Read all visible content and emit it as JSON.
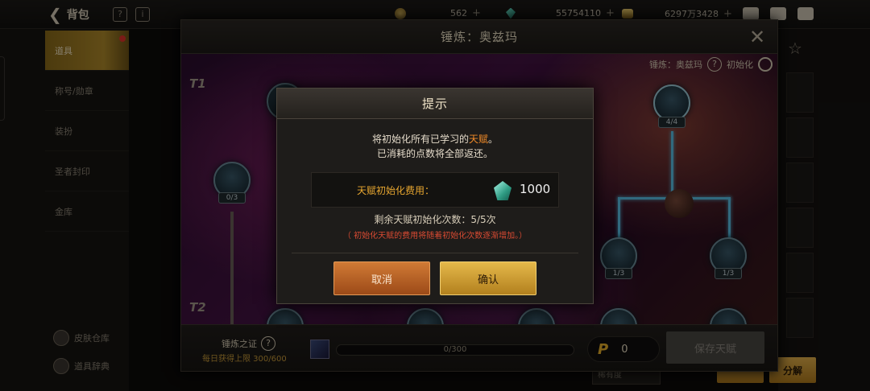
{
  "topbar": {
    "back_label": "背包",
    "currencies": [
      {
        "icon": "coin-icon",
        "value": "562"
      },
      {
        "icon": "gem-icon",
        "value": "55754110"
      },
      {
        "icon": "gold-icon",
        "value": "6297万3428"
      }
    ]
  },
  "sidebar": {
    "items": [
      {
        "label": "道具",
        "active": true,
        "badge": true
      },
      {
        "label": "称号/勋章"
      },
      {
        "label": "装扮"
      },
      {
        "label": "圣者封印"
      },
      {
        "label": "金库"
      }
    ],
    "bottom": [
      {
        "label": "皮肤仓库",
        "icon": "skin-storage-icon"
      },
      {
        "label": "道具辞典",
        "icon": "item-dictionary-icon"
      }
    ]
  },
  "right_panel": {
    "split_label": "分解",
    "bottom_select": "稀有度"
  },
  "forge": {
    "title": "锤炼：奥兹玛",
    "info_label": "锤炼：奥兹玛",
    "reset_label": "初始化",
    "tiers": [
      "T1",
      "T2"
    ],
    "nodes": [
      {
        "count": "0/3"
      },
      {
        "count": "4/4"
      },
      {
        "count": "1/3"
      },
      {
        "count": "1/3"
      }
    ],
    "footer": {
      "proof_title": "锤炼之证",
      "daily_limit": "每日获得上限 300/600",
      "progress": "0/300",
      "points": "0",
      "save_label": "保存天赋"
    }
  },
  "dialog": {
    "title": "提示",
    "message_line1_pre": "将初始化所有已学习的",
    "message_line1_highlight": "天赋",
    "message_line1_post": "。",
    "message_line2": "已消耗的点数将全部返还。",
    "cost_label": "天赋初始化费用：",
    "cost_value": "1000",
    "remaining": "剩余天赋初始化次数：5/5次",
    "note": "（ 初始化天赋的费用将随着初始化次数逐渐增加。）",
    "cancel_label": "取消",
    "confirm_label": "确认"
  },
  "colors": {
    "accent_gold": "#e5b84a",
    "cancel_orange": "#d07a35",
    "highlight_orange": "#f08a28",
    "warning_red": "#d84a32",
    "talent_line": "#59c0e6"
  }
}
